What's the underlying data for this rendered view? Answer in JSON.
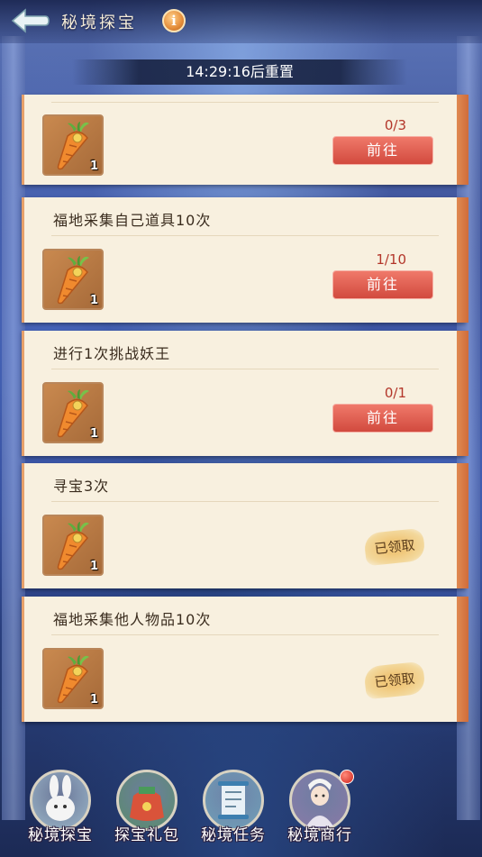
{
  "header": {
    "title": "秘境探宝",
    "timer": "14:29:16后重置"
  },
  "tasks": [
    {
      "title": "",
      "reward_qty": "1",
      "progress": "0/3",
      "action": "前往",
      "status": "go"
    },
    {
      "title": "福地采集自己道具10次",
      "reward_qty": "1",
      "progress": "1/10",
      "action": "前往",
      "status": "go"
    },
    {
      "title": "进行1次挑战妖王",
      "reward_qty": "1",
      "progress": "0/1",
      "action": "前往",
      "status": "go"
    },
    {
      "title": "寻宝3次",
      "reward_qty": "1",
      "progress": "",
      "action": "已领取",
      "status": "claimed"
    },
    {
      "title": "福地采集他人物品10次",
      "reward_qty": "1",
      "progress": "",
      "action": "已领取",
      "status": "claimed"
    }
  ],
  "nav": [
    {
      "label": "秘境探宝",
      "icon": "rabbit-icon",
      "color": "#9bb6c9"
    },
    {
      "label": "探宝礼包",
      "icon": "gift-bag-icon",
      "color": "#5a8e6a"
    },
    {
      "label": "秘境任务",
      "icon": "scroll-icon",
      "color": "#6fa0b8"
    },
    {
      "label": "秘境商行",
      "icon": "merchant-icon",
      "color": "#8a7aa8",
      "badge": true
    }
  ]
}
